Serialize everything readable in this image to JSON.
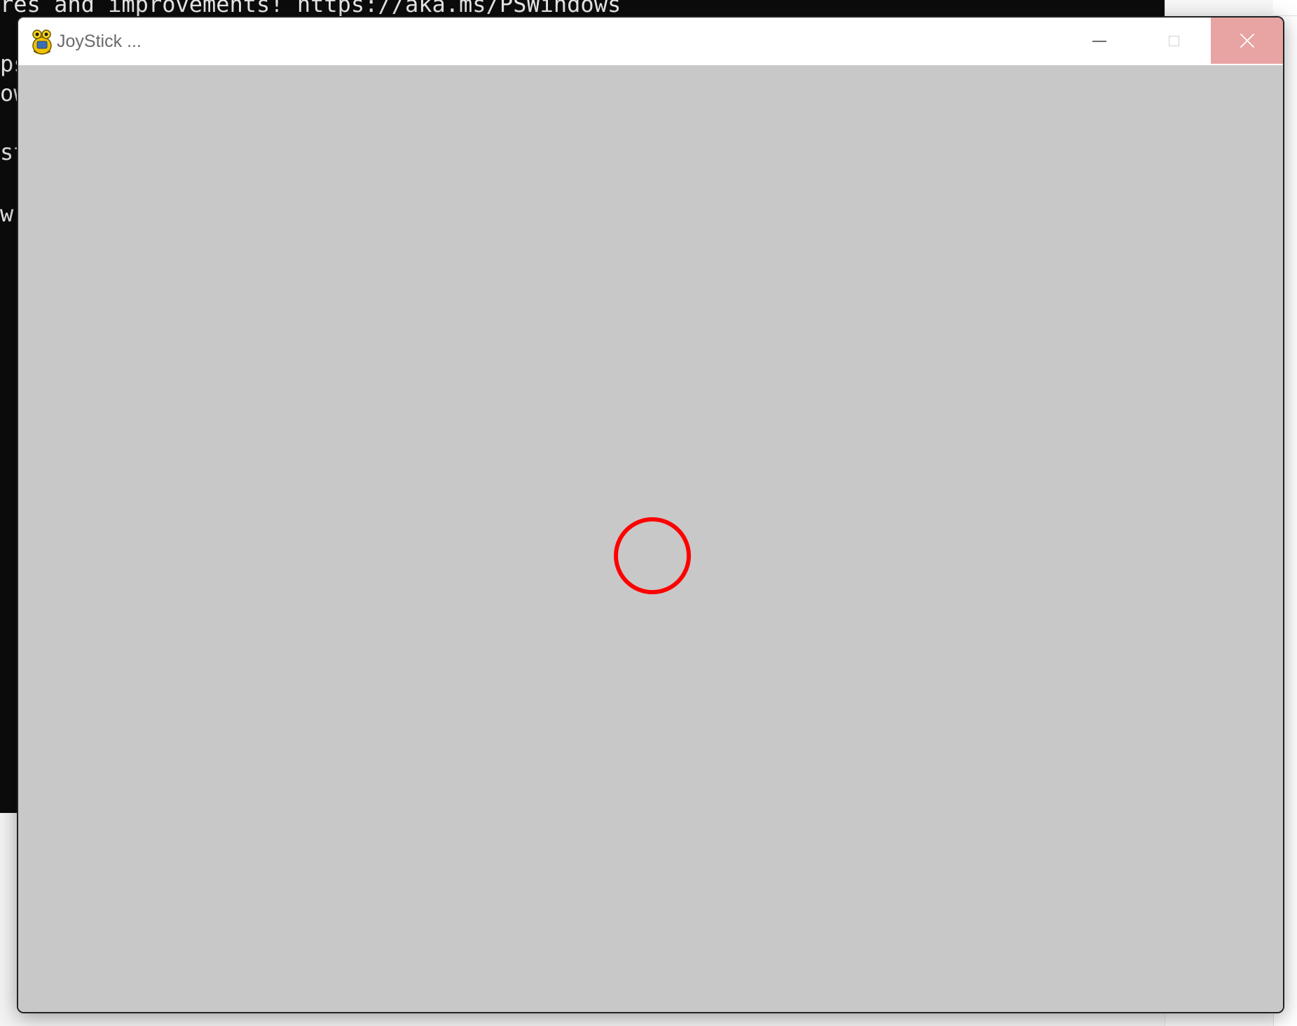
{
  "terminal": {
    "lines": [
      "res and improvements! https://aka.ms/PSWindows",
      "ps",
      "ow",
      "",
      "st",
      "",
      "w."
    ]
  },
  "window": {
    "title": "JoyStick ...",
    "icon": "pygame-snake-icon",
    "buttons": {
      "minimize": "minimize-icon",
      "maximize": "maximize-icon",
      "close": "close-icon"
    }
  },
  "canvas": {
    "background": "#c8c8c8",
    "cursor_circle": {
      "stroke": "#ff0000"
    }
  }
}
